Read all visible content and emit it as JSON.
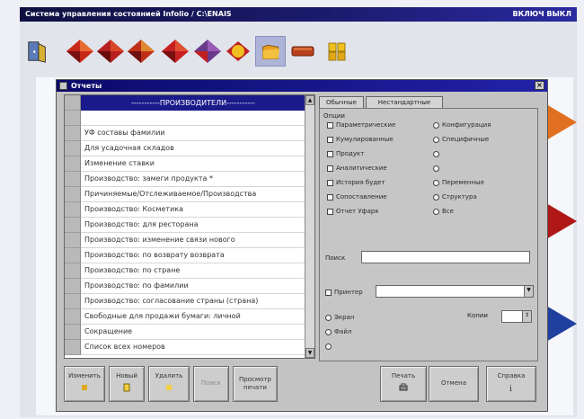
{
  "app": {
    "title": "Система управления состоянией Infolio / C:\\ENAIS",
    "title_right": "ВКЛЮЧ ВЫКЛ"
  },
  "toolbar": {
    "icons": [
      "exit-door-icon",
      "rhombus-red-icon",
      "rhombus-red-icon",
      "rhombus-red-icon",
      "rhombus-red-icon",
      "rhombus-purple-icon",
      "sun-icon",
      "folder-icon",
      "brick-icon",
      "yellow-blocks-icon"
    ]
  },
  "dialog": {
    "title": "Отчеты",
    "close": "×",
    "list": {
      "items": [
        "-----------ПРОИЗВОДИТЕЛИ-----------",
        "",
        "УФ составы фамилии",
        "Для усадочная складов",
        "Изменение ставки",
        "Производство: замеги продукта *",
        "Причиняемые/Отслеживаемое/Производства",
        "Производство: Косметика",
        "Производство: для ресторана",
        "Производство: изменение связи нового",
        "Производство: по возврату возврата",
        "Производство: по стране",
        "Производство: по фамилии",
        "Производство: согласование страны (страна)",
        "Свободные для продажи бумаги: личной",
        "Сокращение",
        "Список всех номеров"
      ],
      "selected_index": 0
    },
    "tabs": [
      {
        "label": "Обычные"
      },
      {
        "label": "Нестандартные"
      }
    ],
    "options_label": "Опции",
    "options_left": [
      {
        "label": "Параметрические",
        "checked": false
      },
      {
        "label": "Кумулированные",
        "checked": false
      },
      {
        "label": "Продукт",
        "checked": false
      },
      {
        "label": "Аналитические",
        "checked": false
      },
      {
        "label": "История будет",
        "checked": false
      },
      {
        "label": "Сопоставление",
        "checked": false
      },
      {
        "label": "Отчет Уфарк",
        "checked": false
      }
    ],
    "options_right": [
      {
        "label": "Конфигурация",
        "checked": false
      },
      {
        "label": "Специфичные",
        "checked": false
      },
      {
        "label": "",
        "checked": false
      },
      {
        "label": "",
        "checked": false
      },
      {
        "label": "Переменные",
        "checked": false
      },
      {
        "label": "Структура",
        "checked": false
      },
      {
        "label": "Все",
        "checked": false
      }
    ],
    "search_label": "Поиск",
    "search_value": "",
    "printer_label": "Принтер",
    "printer_value": "",
    "output_options": [
      {
        "label": "Экран"
      },
      {
        "label": "Файл"
      },
      {
        "label": ""
      }
    ],
    "copies_label": "Копии",
    "copies_value": "",
    "buttons": {
      "change": "Изменить",
      "new": "Новый",
      "delete": "Удалить",
      "search": "Поиск",
      "preview": "Просмотр печати",
      "print": "Печать",
      "cancel": "Отмена",
      "help": "Справка"
    }
  }
}
